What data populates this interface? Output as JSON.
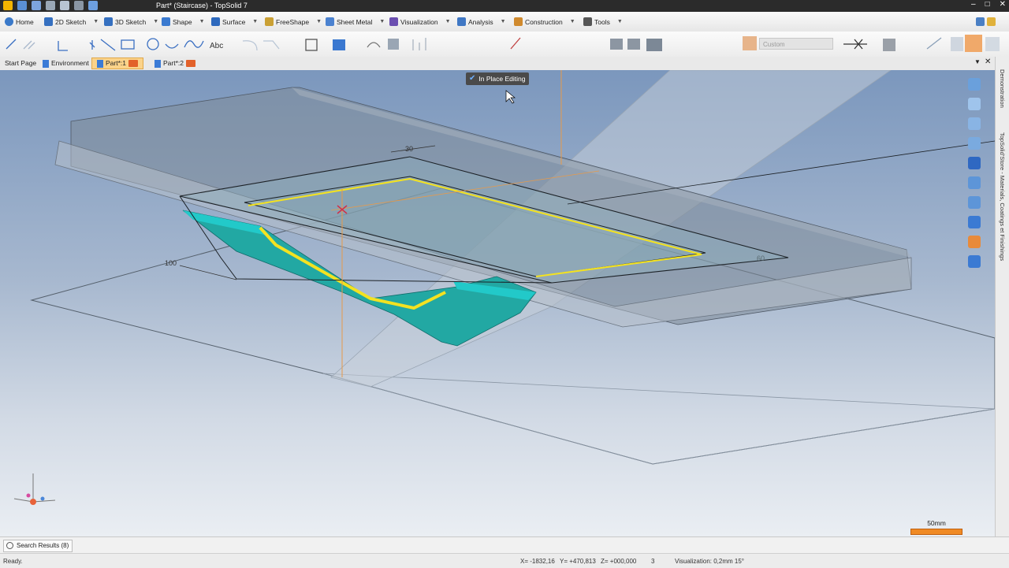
{
  "window": {
    "title": "Part* (Staircase) - TopSolid 7"
  },
  "ribbon_tabs": [
    {
      "label": "Home",
      "icon": "home-icon",
      "color": "#3a79c9"
    },
    {
      "label": "2D Sketch",
      "icon": "pencil-icon",
      "color": "#3570c0"
    },
    {
      "label": "3D Sketch",
      "icon": "pencil-3d-icon",
      "color": "#3570c0"
    },
    {
      "label": "Shape",
      "icon": "cube-icon",
      "color": "#3a7ad0"
    },
    {
      "label": "Surface",
      "icon": "surface-icon",
      "color": "#2d69bd"
    },
    {
      "label": "FreeShape",
      "icon": "freeshape-icon",
      "color": "#caa034"
    },
    {
      "label": "Sheet Metal",
      "icon": "sheetmetal-icon",
      "color": "#4b82d0"
    },
    {
      "label": "Visualization",
      "icon": "visualization-icon",
      "color": "#6b4fb0"
    },
    {
      "label": "Analysis",
      "icon": "analysis-icon",
      "color": "#3f77c4"
    },
    {
      "label": "Construction",
      "icon": "construction-icon",
      "color": "#d08a2e"
    },
    {
      "label": "Tools",
      "icon": "tools-icon",
      "color": "#555555"
    }
  ],
  "toolbar": {
    "style_field": "Custom"
  },
  "doc_tabs": [
    {
      "label": "Start Page",
      "active": false
    },
    {
      "label": "Environment",
      "active": false
    },
    {
      "label": "Part*:1",
      "active": true
    },
    {
      "label": "Part*:2",
      "active": false
    }
  ],
  "viewport": {
    "in_place_editing": "In Place Editing",
    "dimension_top": "30",
    "dimension_left": "100",
    "dimension_right": "60",
    "scale_label": "50mm",
    "colors": {
      "teal": "#22c9c9",
      "yellow": "#f3e221",
      "orange": "#f08a24"
    }
  },
  "side_panel": {
    "label_top": "Demonstration",
    "label_bottom": "TopSolid'Store - Materials, Coatings et Finishings"
  },
  "results": {
    "search_label": "Search Results (8)"
  },
  "status": {
    "ready": "Ready.",
    "x": "X= -1832,16",
    "y": "Y= +470,813",
    "z": "Z= +000,000",
    "count": "3",
    "visualization": "Visualization: 0,2mm 15°"
  }
}
